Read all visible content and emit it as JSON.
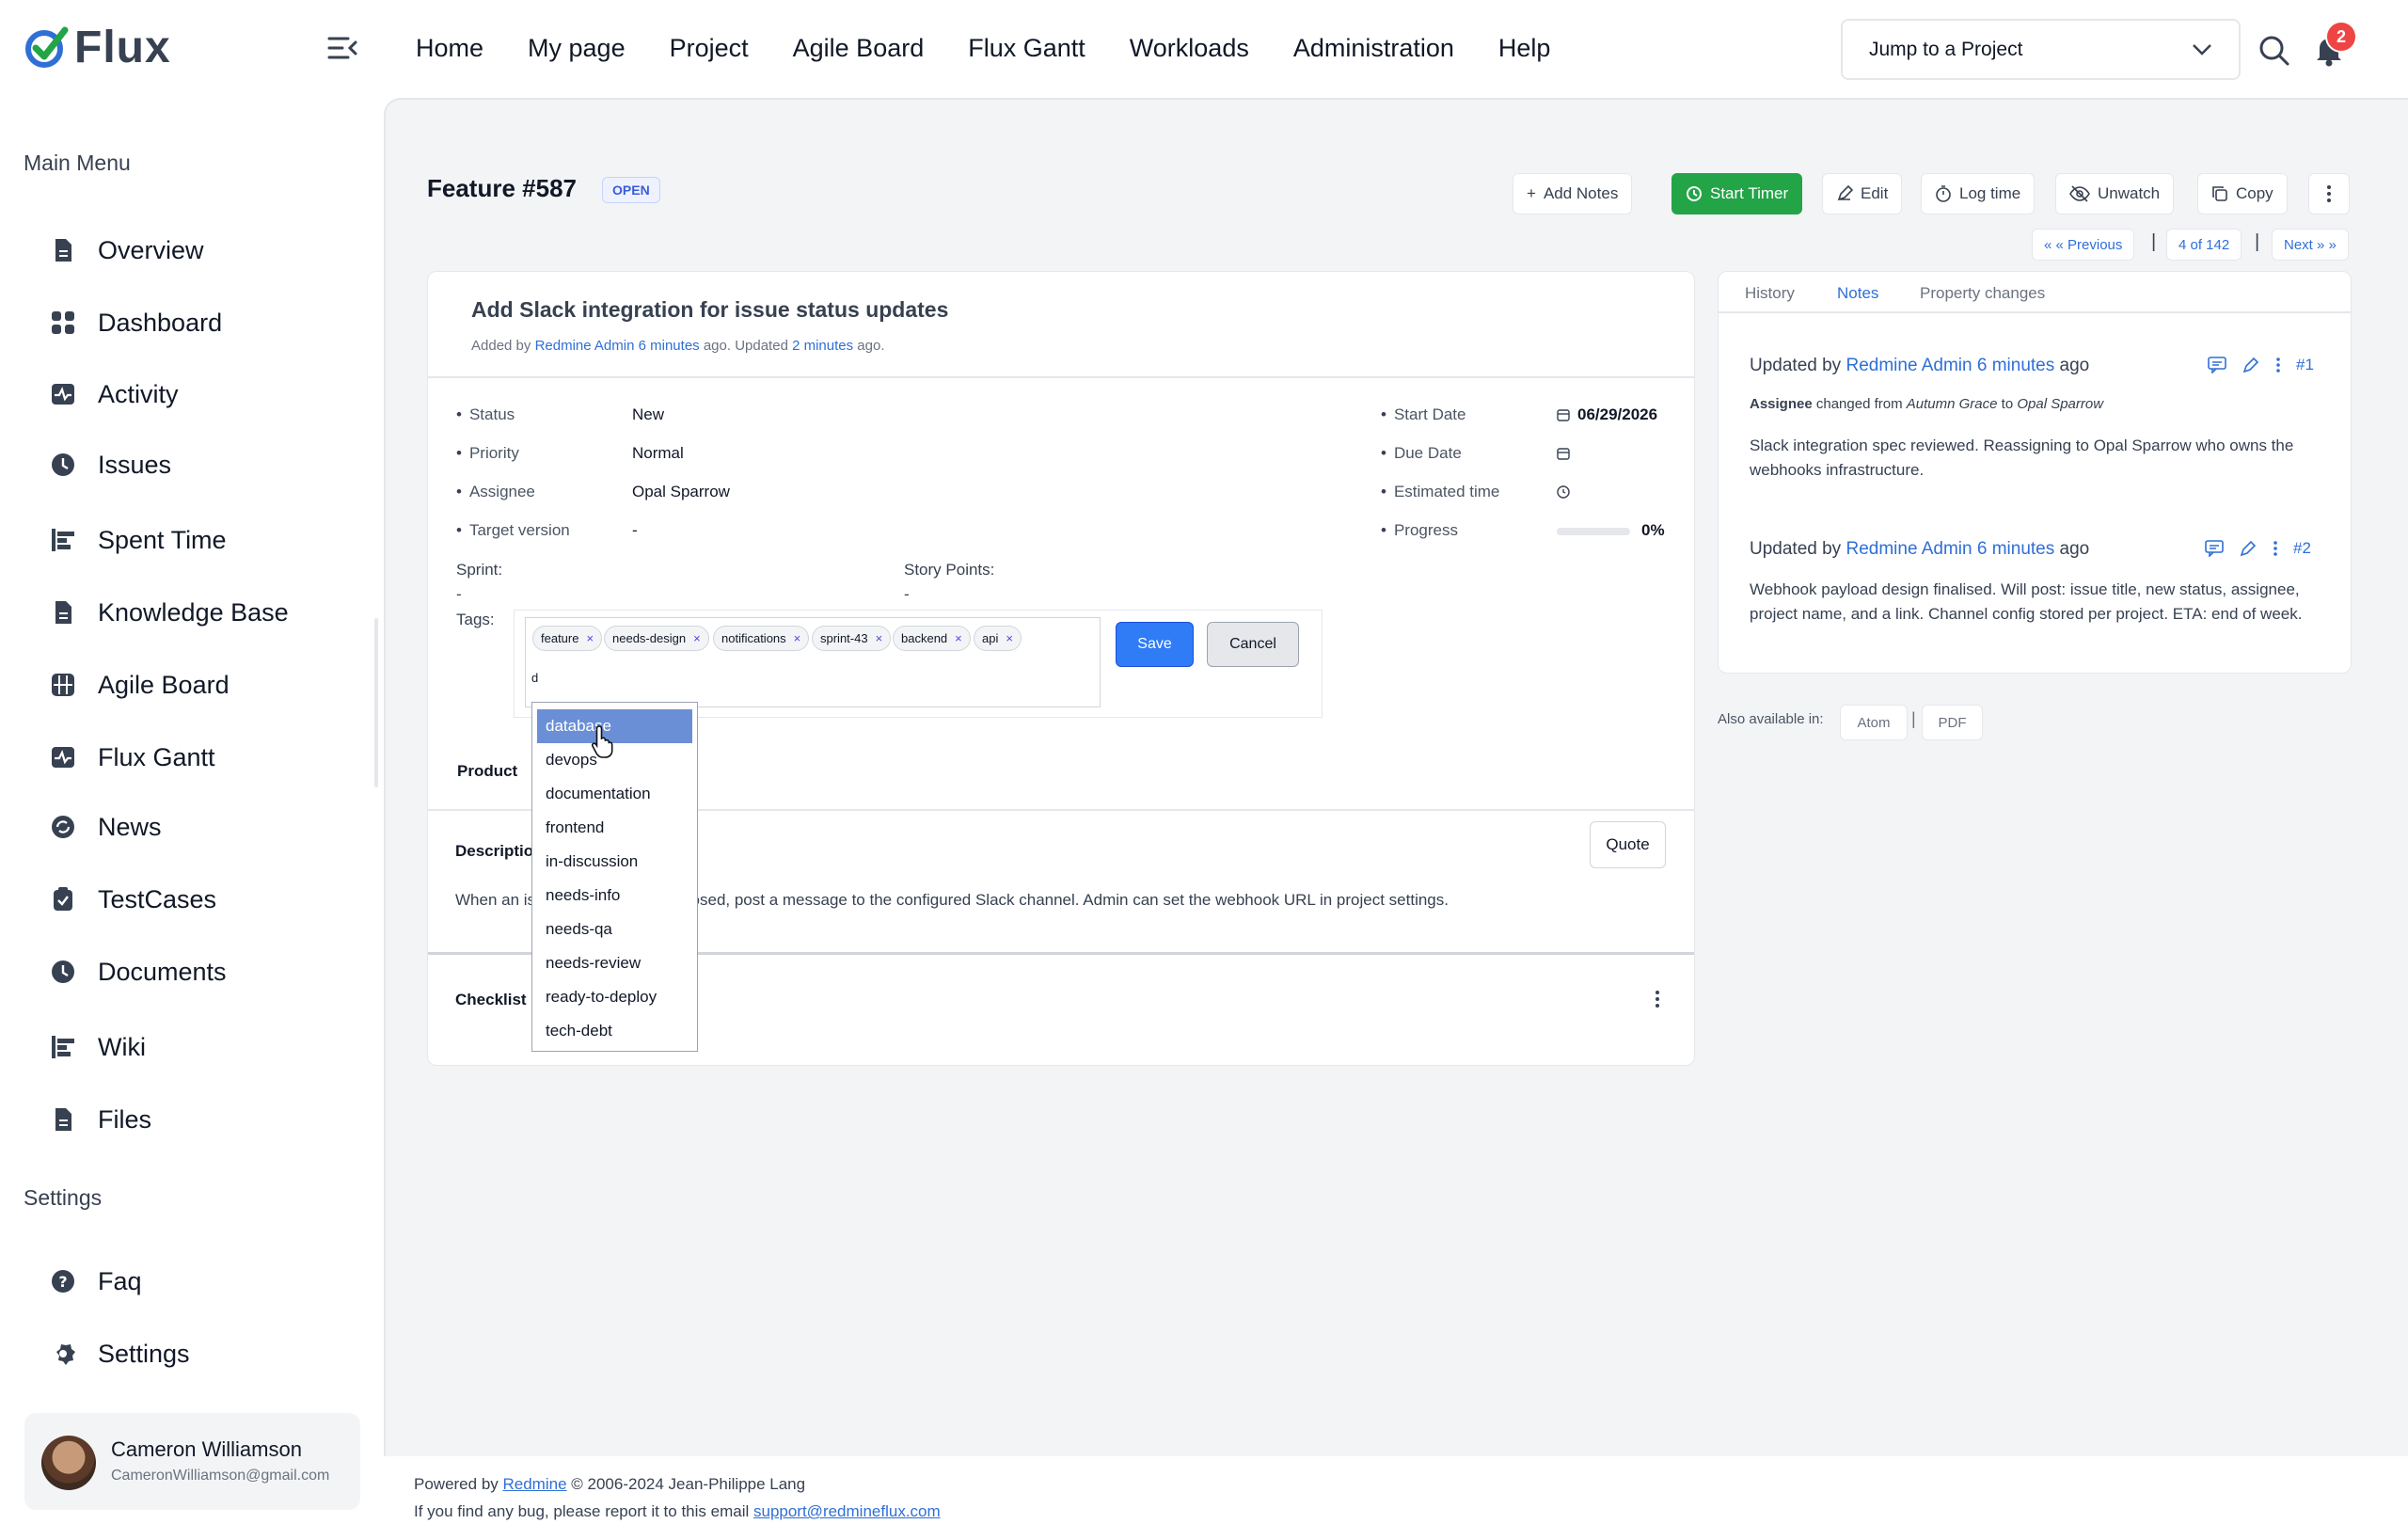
{
  "app": {
    "name": "Flux"
  },
  "nav": [
    "Home",
    "My page",
    "Project",
    "Agile Board",
    "Flux Gantt",
    "Workloads",
    "Administration",
    "Help"
  ],
  "jump": {
    "placeholder": "Jump to a Project"
  },
  "notifications": {
    "count": "2"
  },
  "sidebar": {
    "main_heading": "Main Menu",
    "items": [
      {
        "label": "Overview",
        "icon": "document-icon"
      },
      {
        "label": "Dashboard",
        "icon": "grid-icon"
      },
      {
        "label": "Activity",
        "icon": "activity-icon"
      },
      {
        "label": "Issues",
        "icon": "clock-icon"
      },
      {
        "label": "Spent Time",
        "icon": "bars-icon"
      },
      {
        "label": "Knowledge Base",
        "icon": "document-icon"
      },
      {
        "label": "Agile Board",
        "icon": "board-icon"
      },
      {
        "label": "Flux Gantt",
        "icon": "activity-icon"
      },
      {
        "label": "News",
        "icon": "refresh-icon"
      },
      {
        "label": "TestCases",
        "icon": "clipboard-icon"
      },
      {
        "label": "Documents",
        "icon": "clock-icon"
      },
      {
        "label": "Wiki",
        "icon": "bars-icon"
      },
      {
        "label": "Files",
        "icon": "document-icon"
      }
    ],
    "settings_heading": "Settings",
    "settings_items": [
      {
        "label": "Faq",
        "icon": "help-icon"
      },
      {
        "label": "Settings",
        "icon": "gear-icon"
      }
    ]
  },
  "user": {
    "name": "Cameron Williamson",
    "email": "CameronWilliamson@gmail.com"
  },
  "issue": {
    "title": "Feature #587",
    "status_badge": "OPEN",
    "subject": "Add Slack integration for issue status updates",
    "added_prefix": "Added by ",
    "author": "Redmine Admin",
    "added_ago": "6 minutes",
    "updated_prefix": " ago. Updated ",
    "updated_ago": "2 minutes",
    "updated_suffix": " ago.",
    "attributes_left": [
      {
        "label": "Status",
        "value": "New"
      },
      {
        "label": "Priority",
        "value": "Normal"
      },
      {
        "label": "Assignee",
        "value": "Opal Sparrow"
      },
      {
        "label": "Target version",
        "value": "-"
      }
    ],
    "attributes_right": [
      {
        "label": "Start Date",
        "value": "06/29/2026"
      },
      {
        "label": "Due Date",
        "value": ""
      },
      {
        "label": "Estimated time",
        "value": ""
      },
      {
        "label": "Progress",
        "value": "0%"
      }
    ],
    "progress": 0,
    "sprint_label": "Sprint:",
    "sprint_value": "-",
    "story_points_label": "Story Points:",
    "story_points_value": "-",
    "tags_label": "Tags:",
    "product_label": "Product",
    "description_label": "Description",
    "description_start": "When an is",
    "description_end": "Resolved or Closed, post a message to the configured Slack channel. Admin can set the webhook URL in project settings.",
    "checklist_label": "Checklist"
  },
  "toolbar": {
    "add_notes": "Add Notes",
    "start_timer": "Start Timer",
    "edit": "Edit",
    "log_time": "Log time",
    "unwatch": "Unwatch",
    "copy": "Copy",
    "quote": "Quote"
  },
  "pager": {
    "previous": "« « Previous",
    "position": "4 of 142",
    "next": "Next » »",
    "separator": "|"
  },
  "tags_editor": {
    "tags": [
      "feature",
      "needs-design",
      "notifications",
      "sprint-43",
      "backend",
      "api"
    ],
    "remove_glyph": "×",
    "typed": "d",
    "save": "Save",
    "cancel": "Cancel",
    "suggestions": [
      "database",
      "devops",
      "documentation",
      "frontend",
      "in-discussion",
      "needs-info",
      "needs-qa",
      "needs-review",
      "ready-to-deploy",
      "tech-debt"
    ],
    "highlighted": "database"
  },
  "right_tabs": [
    "History",
    "Notes",
    "Property changes"
  ],
  "notes": [
    {
      "prefix": "Updated by ",
      "author": "Redmine Admin",
      "ago": "6 minutes",
      "suffix": " ago",
      "number": "#1",
      "detail_field": "Assignee",
      "detail_mid": " changed from ",
      "detail_from": "Autumn Grace",
      "detail_to_word": " to ",
      "detail_to": "Opal Sparrow",
      "body": "Slack integration spec reviewed. Reassigning to Opal Sparrow who owns the webhooks infrastructure."
    },
    {
      "prefix": "Updated by ",
      "author": "Redmine Admin",
      "ago": "6 minutes",
      "suffix": " ago",
      "number": "#2",
      "body": "Webhook payload design finalised. Will post: issue title, new status, assignee, project name, and a link. Channel config stored per project. ETA: end of week."
    }
  ],
  "also_available": {
    "label": "Also available in:",
    "formats": [
      "Atom",
      "PDF"
    ],
    "separator": "|"
  },
  "footer": {
    "powered_prefix": "Powered by ",
    "powered_link": "Redmine",
    "powered_suffix": " © 2006-2024 Jean-Philippe Lang",
    "bug_text": "If you find any bug, please report it to this email ",
    "bug_email": "support@redmineflux.com"
  },
  "colors": {
    "accent": "#2f6fd6",
    "green": "#22a447",
    "badge": "#ef4444"
  }
}
